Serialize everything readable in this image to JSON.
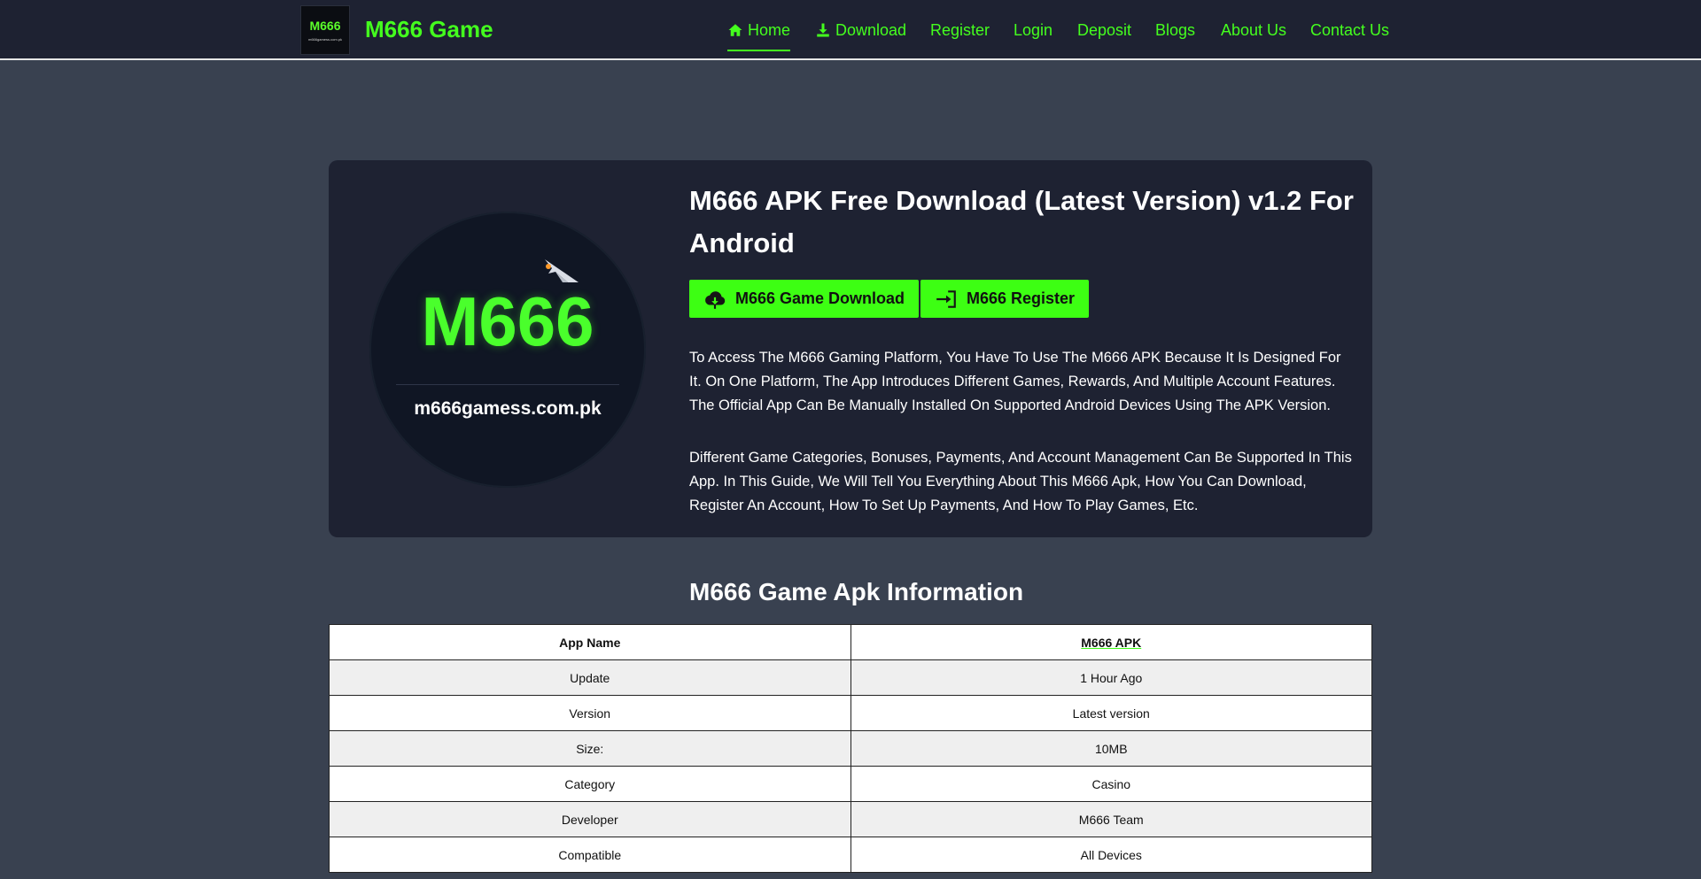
{
  "header": {
    "logo_text": "M666",
    "logo_subtext": "m666gamess.com.pk",
    "brand": "M666 Game",
    "nav": [
      {
        "label": "Home",
        "icon": "home-icon",
        "active": true
      },
      {
        "label": "Download",
        "icon": "download-icon"
      },
      {
        "label": "Register"
      },
      {
        "label": "Login"
      },
      {
        "label": "Deposit"
      },
      {
        "label": "Blogs"
      },
      {
        "label": "About Us"
      },
      {
        "label": "Contact Us"
      }
    ]
  },
  "hero": {
    "logo_big": "M666",
    "logo_site": "m666gamess.com.pk",
    "title": "M666 APK Free Download (Latest Version) v1.2 For Android",
    "download_button": "M666 Game Download",
    "register_button": "M666 Register",
    "paragraph1": "To Access The M666 Gaming Platform, You Have To Use The M666 APK Because It Is Designed For It. On One Platform, The App Introduces Different Games, Rewards, And Multiple Account Features. The Official App Can Be Manually Installed On Supported Android Devices Using The APK Version.",
    "paragraph2": "Different Game Categories, Bonuses, Payments, And Account Management Can Be Supported In This App. In This Guide, We Will Tell You Everything About This M666 Apk, How You Can Download, Register An Account, How To Set Up Payments, And How To Play Games, Etc."
  },
  "info": {
    "title": "M666 Game Apk Information",
    "rows": [
      [
        "App Name",
        "M666 APK"
      ],
      [
        "Update",
        "1 Hour Ago"
      ],
      [
        "Version",
        "Latest version"
      ],
      [
        "Size:",
        "10MB"
      ],
      [
        "Category",
        "Casino"
      ],
      [
        "Developer",
        "M666 Team"
      ],
      [
        "Compatible",
        "All Devices"
      ]
    ]
  },
  "colors": {
    "accent": "#3dff13",
    "header_bg": "#1e2232",
    "page_bg": "#394150"
  }
}
